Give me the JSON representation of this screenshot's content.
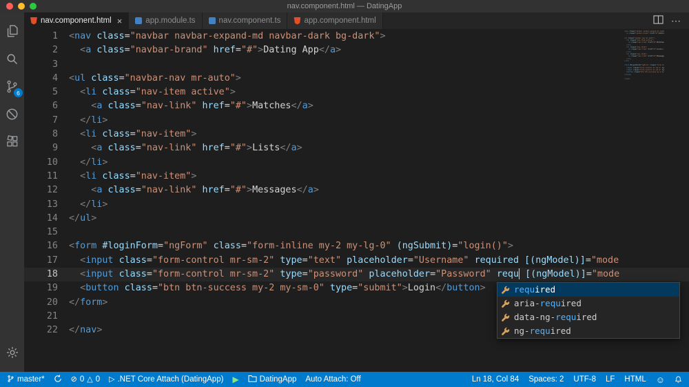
{
  "title_bar": {
    "title": "nav.component.html — DatingApp"
  },
  "activity_bar": {
    "source_control_badge": "6"
  },
  "tabs": [
    {
      "label": "nav.component.html",
      "icon": "html",
      "close": "×"
    },
    {
      "label": "app.module.ts",
      "icon": "ts"
    },
    {
      "label": "nav.component.ts",
      "icon": "ts"
    },
    {
      "label": "app.component.html",
      "icon": "html"
    }
  ],
  "editor_actions": {
    "more": "⋯"
  },
  "editor": {
    "cursor_line": 18,
    "lines": [
      [
        [
          "p",
          "<"
        ],
        [
          "t",
          "nav"
        ],
        [
          "x",
          " "
        ],
        [
          "a",
          "class"
        ],
        [
          "x",
          "="
        ],
        [
          "s",
          "\"navbar navbar-expand-md navbar-dark bg-dark\""
        ],
        [
          "p",
          ">"
        ]
      ],
      [
        [
          "x",
          "  "
        ],
        [
          "p",
          "<"
        ],
        [
          "t",
          "a"
        ],
        [
          "x",
          " "
        ],
        [
          "a",
          "class"
        ],
        [
          "x",
          "="
        ],
        [
          "s",
          "\"navbar-brand\""
        ],
        [
          "x",
          " "
        ],
        [
          "a",
          "href"
        ],
        [
          "x",
          "="
        ],
        [
          "s",
          "\"#\""
        ],
        [
          "p",
          ">"
        ],
        [
          "x",
          "Dating App"
        ],
        [
          "p",
          "</"
        ],
        [
          "t",
          "a"
        ],
        [
          "p",
          ">"
        ]
      ],
      [],
      [
        [
          "p",
          "<"
        ],
        [
          "t",
          "ul"
        ],
        [
          "x",
          " "
        ],
        [
          "a",
          "class"
        ],
        [
          "x",
          "="
        ],
        [
          "s",
          "\"navbar-nav mr-auto\""
        ],
        [
          "p",
          ">"
        ]
      ],
      [
        [
          "x",
          "  "
        ],
        [
          "p",
          "<"
        ],
        [
          "t",
          "li"
        ],
        [
          "x",
          " "
        ],
        [
          "a",
          "class"
        ],
        [
          "x",
          "="
        ],
        [
          "s",
          "\"nav-item active\""
        ],
        [
          "p",
          ">"
        ]
      ],
      [
        [
          "x",
          "    "
        ],
        [
          "p",
          "<"
        ],
        [
          "t",
          "a"
        ],
        [
          "x",
          " "
        ],
        [
          "a",
          "class"
        ],
        [
          "x",
          "="
        ],
        [
          "s",
          "\"nav-link\""
        ],
        [
          "x",
          " "
        ],
        [
          "a",
          "href"
        ],
        [
          "x",
          "="
        ],
        [
          "s",
          "\"#\""
        ],
        [
          "p",
          ">"
        ],
        [
          "x",
          "Matches"
        ],
        [
          "p",
          "</"
        ],
        [
          "t",
          "a"
        ],
        [
          "p",
          ">"
        ]
      ],
      [
        [
          "x",
          "  "
        ],
        [
          "p",
          "</"
        ],
        [
          "t",
          "li"
        ],
        [
          "p",
          ">"
        ]
      ],
      [
        [
          "x",
          "  "
        ],
        [
          "p",
          "<"
        ],
        [
          "t",
          "li"
        ],
        [
          "x",
          " "
        ],
        [
          "a",
          "class"
        ],
        [
          "x",
          "="
        ],
        [
          "s",
          "\"nav-item\""
        ],
        [
          "p",
          ">"
        ]
      ],
      [
        [
          "x",
          "    "
        ],
        [
          "p",
          "<"
        ],
        [
          "t",
          "a"
        ],
        [
          "x",
          " "
        ],
        [
          "a",
          "class"
        ],
        [
          "x",
          "="
        ],
        [
          "s",
          "\"nav-link\""
        ],
        [
          "x",
          " "
        ],
        [
          "a",
          "href"
        ],
        [
          "x",
          "="
        ],
        [
          "s",
          "\"#\""
        ],
        [
          "p",
          ">"
        ],
        [
          "x",
          "Lists"
        ],
        [
          "p",
          "</"
        ],
        [
          "t",
          "a"
        ],
        [
          "p",
          ">"
        ]
      ],
      [
        [
          "x",
          "  "
        ],
        [
          "p",
          "</"
        ],
        [
          "t",
          "li"
        ],
        [
          "p",
          ">"
        ]
      ],
      [
        [
          "x",
          "  "
        ],
        [
          "p",
          "<"
        ],
        [
          "t",
          "li"
        ],
        [
          "x",
          " "
        ],
        [
          "a",
          "class"
        ],
        [
          "x",
          "="
        ],
        [
          "s",
          "\"nav-item\""
        ],
        [
          "p",
          ">"
        ]
      ],
      [
        [
          "x",
          "    "
        ],
        [
          "p",
          "<"
        ],
        [
          "t",
          "a"
        ],
        [
          "x",
          " "
        ],
        [
          "a",
          "class"
        ],
        [
          "x",
          "="
        ],
        [
          "s",
          "\"nav-link\""
        ],
        [
          "x",
          " "
        ],
        [
          "a",
          "href"
        ],
        [
          "x",
          "="
        ],
        [
          "s",
          "\"#\""
        ],
        [
          "p",
          ">"
        ],
        [
          "x",
          "Messages"
        ],
        [
          "p",
          "</"
        ],
        [
          "t",
          "a"
        ],
        [
          "p",
          ">"
        ]
      ],
      [
        [
          "x",
          "  "
        ],
        [
          "p",
          "</"
        ],
        [
          "t",
          "li"
        ],
        [
          "p",
          ">"
        ]
      ],
      [
        [
          "p",
          "</"
        ],
        [
          "t",
          "ul"
        ],
        [
          "p",
          ">"
        ]
      ],
      [],
      [
        [
          "p",
          "<"
        ],
        [
          "t",
          "form"
        ],
        [
          "x",
          " "
        ],
        [
          "a",
          "#loginForm"
        ],
        [
          "x",
          "="
        ],
        [
          "s",
          "\"ngForm\""
        ],
        [
          "x",
          " "
        ],
        [
          "a",
          "class"
        ],
        [
          "x",
          "="
        ],
        [
          "s",
          "\"form-inline my-2 my-lg-0\""
        ],
        [
          "x",
          " "
        ],
        [
          "a",
          "(ngSubmit)"
        ],
        [
          "x",
          "="
        ],
        [
          "s",
          "\"login()\""
        ],
        [
          "p",
          ">"
        ]
      ],
      [
        [
          "x",
          "  "
        ],
        [
          "p",
          "<"
        ],
        [
          "t",
          "input"
        ],
        [
          "x",
          " "
        ],
        [
          "a",
          "class"
        ],
        [
          "x",
          "="
        ],
        [
          "s",
          "\"form-control mr-sm-2\""
        ],
        [
          "x",
          " "
        ],
        [
          "a",
          "type"
        ],
        [
          "x",
          "="
        ],
        [
          "s",
          "\"text\""
        ],
        [
          "x",
          " "
        ],
        [
          "a",
          "placeholder"
        ],
        [
          "x",
          "="
        ],
        [
          "s",
          "\"Username\""
        ],
        [
          "x",
          " "
        ],
        [
          "a",
          "required"
        ],
        [
          "x",
          " "
        ],
        [
          "a",
          "[(ngModel)]"
        ],
        [
          "x",
          "="
        ],
        [
          "s",
          "\"mode"
        ]
      ],
      [
        [
          "x",
          "  "
        ],
        [
          "p",
          "<"
        ],
        [
          "t",
          "input"
        ],
        [
          "x",
          " "
        ],
        [
          "a",
          "class"
        ],
        [
          "x",
          "="
        ],
        [
          "s",
          "\"form-control mr-sm-2\""
        ],
        [
          "x",
          " "
        ],
        [
          "a",
          "type"
        ],
        [
          "x",
          "="
        ],
        [
          "s",
          "\"password\""
        ],
        [
          "x",
          " "
        ],
        [
          "a",
          "placeholder"
        ],
        [
          "x",
          "="
        ],
        [
          "s",
          "\"Password\""
        ],
        [
          "x",
          " "
        ],
        [
          "a",
          "requ"
        ],
        [
          "cur",
          ""
        ],
        [
          "x",
          " "
        ],
        [
          "a",
          "[(ngModel)]"
        ],
        [
          "x",
          "="
        ],
        [
          "s",
          "\"mode"
        ]
      ],
      [
        [
          "x",
          "  "
        ],
        [
          "p",
          "<"
        ],
        [
          "t",
          "button"
        ],
        [
          "x",
          " "
        ],
        [
          "a",
          "class"
        ],
        [
          "x",
          "="
        ],
        [
          "s",
          "\"btn btn-success my-2 my-sm-0\""
        ],
        [
          "x",
          " "
        ],
        [
          "a",
          "type"
        ],
        [
          "x",
          "="
        ],
        [
          "s",
          "\"submit\""
        ],
        [
          "p",
          ">"
        ],
        [
          "x",
          "Login"
        ],
        [
          "p",
          "</"
        ],
        [
          "t",
          "button"
        ],
        [
          "p",
          ">"
        ]
      ],
      [
        [
          "p",
          "</"
        ],
        [
          "t",
          "form"
        ],
        [
          "p",
          ">"
        ]
      ],
      [],
      [
        [
          "p",
          "</"
        ],
        [
          "t",
          "nav"
        ],
        [
          "p",
          ">"
        ]
      ]
    ]
  },
  "suggest": {
    "items": [
      {
        "pre": "",
        "match": "requ",
        "post": "ired",
        "selected": true
      },
      {
        "pre": "aria-",
        "match": "requ",
        "post": "ired",
        "selected": false
      },
      {
        "pre": "data-ng-",
        "match": "requ",
        "post": "ired",
        "selected": false
      },
      {
        "pre": "ng-",
        "match": "requ",
        "post": "ired",
        "selected": false
      }
    ]
  },
  "status_bar": {
    "branch": "master*",
    "error_icon": "⊘",
    "errors": "0",
    "warning_icon": "△",
    "warnings": "0",
    "debug_icon": "▷",
    "debug_config": ".NET Core Attach (DatingApp)",
    "play_icon": "▶",
    "folder": "DatingApp",
    "auto_attach": "Auto Attach: Off",
    "cursor_position": "Ln 18, Col 84",
    "indentation": "Spaces: 2",
    "encoding": "UTF-8",
    "eol": "LF",
    "language": "HTML",
    "smiley_icon": "☺"
  }
}
